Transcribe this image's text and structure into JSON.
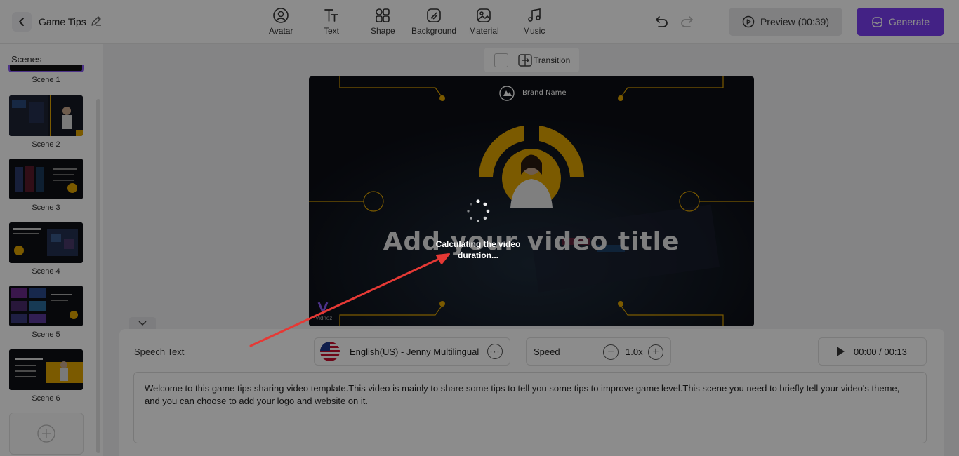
{
  "header": {
    "project_name": "Game Tips",
    "tools": [
      {
        "label": "Avatar"
      },
      {
        "label": "Text"
      },
      {
        "label": "Shape"
      },
      {
        "label": "Background"
      },
      {
        "label": "Material"
      },
      {
        "label": "Music"
      }
    ],
    "preview_label": "Preview (00:39)",
    "generate_label": "Generate"
  },
  "sidebar": {
    "title": "Scenes",
    "scenes": [
      {
        "label": "Scene 1"
      },
      {
        "label": "Scene 2"
      },
      {
        "label": "Scene 3"
      },
      {
        "label": "Scene 4"
      },
      {
        "label": "Scene 5"
      },
      {
        "label": "Scene 6"
      }
    ]
  },
  "canvas": {
    "transition_label": "Transition",
    "video": {
      "brand_name": "Brand Name",
      "title": "Add your video title",
      "watermark": "Vidnoz"
    }
  },
  "editor": {
    "speech_label": "Speech Text",
    "voice": "English(US) - Jenny Multilingual",
    "speed_label": "Speed",
    "speed_value": "1.0x",
    "audio_time": "00:00 / 00:13",
    "speech_text": "Welcome to this game tips sharing video template.This video is mainly to share some tips to tell you some tips to improve game level.This scene you need to briefly tell your video's theme, and you can choose to add your logo and website on it."
  },
  "overlay": {
    "loading_text": "Calculating the video duration..."
  },
  "colors": {
    "accent": "#7b3ff2",
    "video_gold": "#e0a500",
    "annotation_arrow": "#e53935"
  }
}
